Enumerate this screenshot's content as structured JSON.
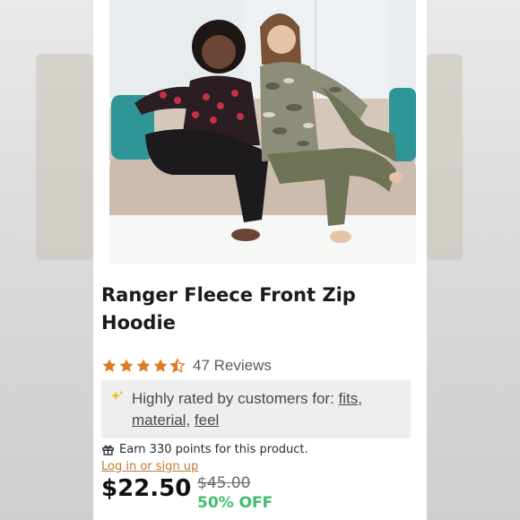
{
  "product": {
    "title_line1": "Ranger Fleece Front Zip",
    "title_line2": "Hoodie",
    "rating_value": 4.5,
    "reviews": "47 Reviews",
    "highlight_prefix": "Highly rated by customers for: ",
    "highlight_tags": [
      "fits",
      "material",
      "feel"
    ],
    "highlight_sep1": ",",
    "highlight_sep2": ", ",
    "points_text": "Earn 330 points for this product.",
    "login_link": "Log in or sign up",
    "price": "$22.50",
    "original_price": "$45.00",
    "discount": "50% OFF"
  },
  "colors": {
    "star": "#e07b24",
    "discount": "#3cbf6e",
    "login_link": "#c07a2c",
    "highlight_bg": "#eeeeee"
  },
  "icons": {
    "rating": "star-icon",
    "highlight": "sparkle-icon",
    "points": "gift-icon"
  }
}
